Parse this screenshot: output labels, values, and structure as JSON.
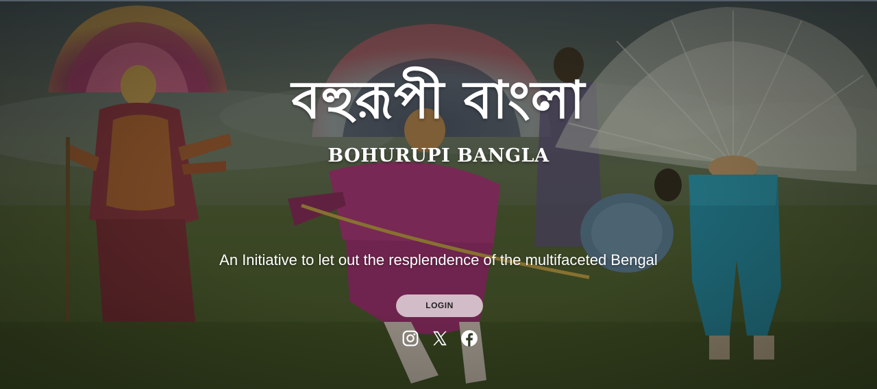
{
  "hero": {
    "title_bn": "বহুরূপী বাংলা",
    "title_en": "BOHURUPI BANGLA",
    "tagline": "An Initiative to let out the resplendence of the multifaceted Bengal",
    "background_image": "chhau-dancers-in-kash-grass-field"
  },
  "actions": {
    "login_label": "LOGIN"
  },
  "social": [
    {
      "name": "Instagram",
      "icon": "instagram-icon"
    },
    {
      "name": "X",
      "icon": "x-icon"
    },
    {
      "name": "Facebook",
      "icon": "facebook-icon"
    }
  ],
  "colors": {
    "text": "#ffffff",
    "button_bg": "#e8dee2",
    "button_text": "#1f1f1f",
    "overlay": "#1e2418"
  }
}
